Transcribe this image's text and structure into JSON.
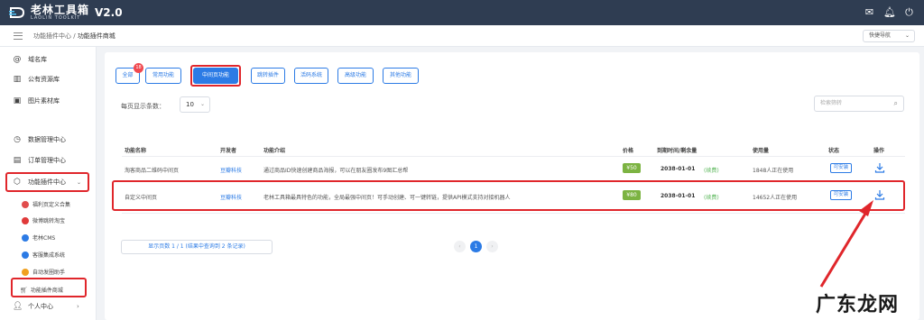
{
  "app": {
    "logo_cn": "老林工具箱",
    "logo_en": "LAOLIN TOOLKIT",
    "version": "V2.0"
  },
  "breadcrumb": {
    "parent": "功能插件中心",
    "separator": " / ",
    "current": "功能插件商城"
  },
  "quick_nav": "快捷导航",
  "sidebar": {
    "items": [
      {
        "label": "域名库",
        "icon": "at-icon"
      },
      {
        "label": "公有资源库",
        "icon": "map-icon"
      },
      {
        "label": "图片素材库",
        "icon": "image-icon"
      },
      {
        "label": "数据管理中心",
        "icon": "clock-icon"
      },
      {
        "label": "订单管理中心",
        "icon": "document-icon"
      },
      {
        "label": "功能插件中心",
        "icon": "cube-icon"
      }
    ],
    "subitems": [
      {
        "label": "福利页定义合集",
        "color": "#e14d4d"
      },
      {
        "label": "微博跳转淘宝",
        "color": "#e03a3a"
      },
      {
        "label": "老林CMS",
        "color": "#2c7be5"
      },
      {
        "label": "客服集成系统",
        "color": "#2c7be5"
      },
      {
        "label": "自动发圈助手",
        "color": "#f0a020"
      },
      {
        "label": "功能插件商城",
        "color": "#888888"
      }
    ],
    "personal": "个人中心"
  },
  "tabs": [
    {
      "label": "全部",
      "badge": "18"
    },
    {
      "label": "常用功能"
    },
    {
      "label": "中间页功能"
    },
    {
      "label": "跳转插件"
    },
    {
      "label": "活码系统"
    },
    {
      "label": "高级功能"
    },
    {
      "label": "其他功能"
    }
  ],
  "per_page_label": "每页显示条数：",
  "per_page_value": "10",
  "search_placeholder": "检索筛转",
  "table": {
    "headers": [
      "功能名称",
      "开发者",
      "功能介绍",
      "价格",
      "到期时间/剩余量",
      "使用量",
      "状态",
      "操作"
    ],
    "rows": [
      {
        "name": "淘客商品二维码中间页",
        "developer": "豆瓣科技",
        "intro": "通过商品ID快速创建商品海报，可以在朋友圈发布9图汇总帮",
        "price": "¥50",
        "expire": "2038-01-01",
        "remain": "(续费)",
        "usage": "1848人正在使用",
        "status": "可安装"
      },
      {
        "name": "自定义中间页",
        "developer": "豆瓣科技",
        "intro": "老林工具箱最具特色的功能，全局最强中间页！可手动创建、可一键转链，提供API模式支持对接机器人",
        "price": "¥80",
        "expire": "2038-01-01",
        "remain": "(续费)",
        "usage": "14652人正在使用",
        "status": "可安装"
      }
    ]
  },
  "pagination": {
    "info": "显示页数 1 / 1 (结果中查询到 2 条记录)",
    "current": "1"
  },
  "watermark": "广东龙网",
  "colors": {
    "primary": "#2c7be5",
    "highlight_red": "#e0262b",
    "price_green": "#7cb342",
    "topbar": "#2f3d52"
  }
}
